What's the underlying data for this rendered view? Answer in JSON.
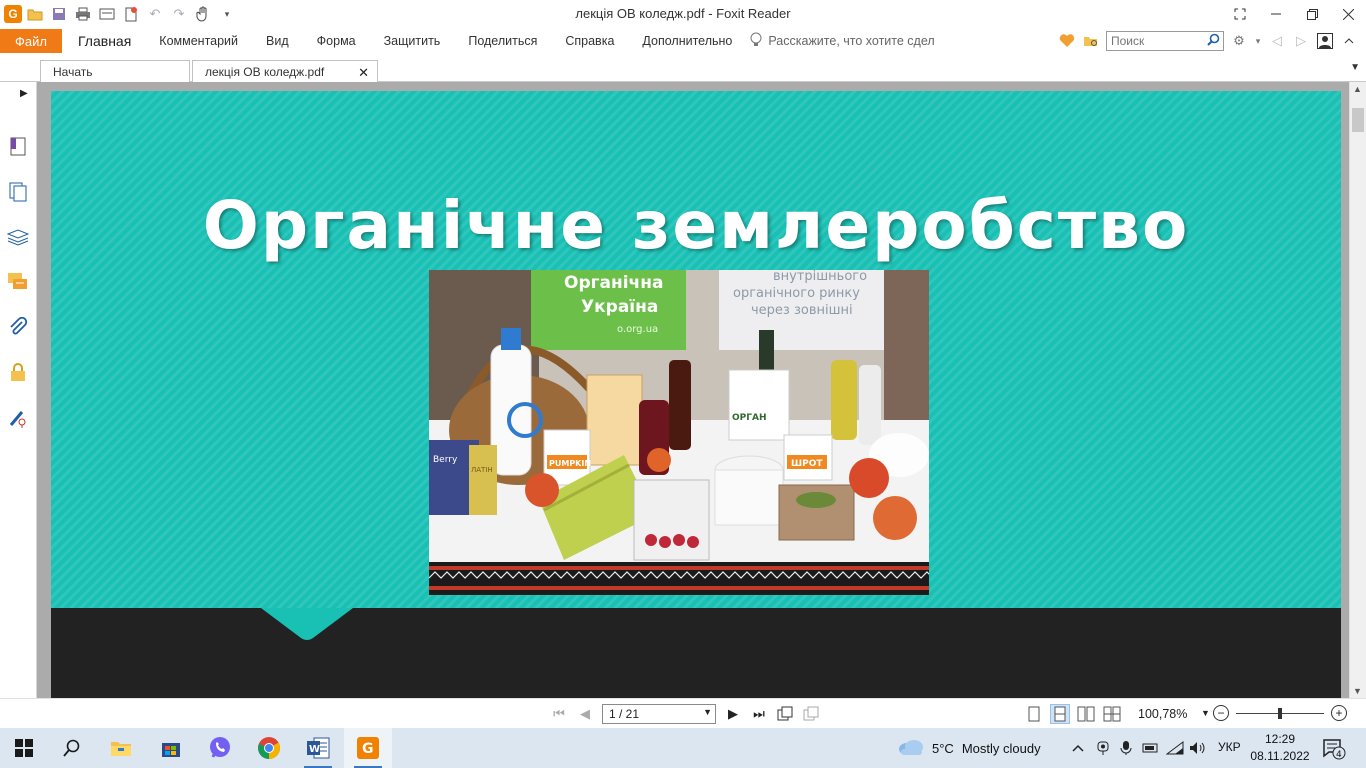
{
  "window": {
    "title": "лекція ОВ коледж.pdf - Foxit Reader"
  },
  "ribbon": {
    "file": "Файл",
    "tabs": [
      "Главная",
      "Комментарий",
      "Вид",
      "Форма",
      "Защитить",
      "Поделиться",
      "Справка",
      "Дополнительно"
    ],
    "tell_me": "Расскажите, что хотите сдел",
    "search_placeholder": "Поиск"
  },
  "doc_tabs": {
    "start": "Начать",
    "current": "лекція ОВ коледж.pdf"
  },
  "slide": {
    "title": "Органічне землеробство",
    "photo_sign_1": "Органічна",
    "photo_sign_2": "Україна",
    "photo_sign_url": "o.org.ua",
    "banner_line_1": "внутрішнього",
    "banner_line_2": "органічного ринку",
    "banner_line_3": "через зовнішні",
    "labels": {
      "pumpkin": "PUMPKIN",
      "shrot": "ШРОТ",
      "organic": "ОРГАН",
      "berry": "Berry",
      "latin": "ЛАТІН"
    },
    "colors": {
      "teal": "#19c0b4",
      "dark": "#222222"
    }
  },
  "statusbar": {
    "page_indicator": "1 / 21",
    "zoom": "100,78%"
  },
  "taskbar": {
    "weather_temp": "5°C",
    "weather_text": "Mostly cloudy",
    "language": "УКР",
    "time": "12:29",
    "date": "08.11.2022",
    "notifications": "4"
  }
}
